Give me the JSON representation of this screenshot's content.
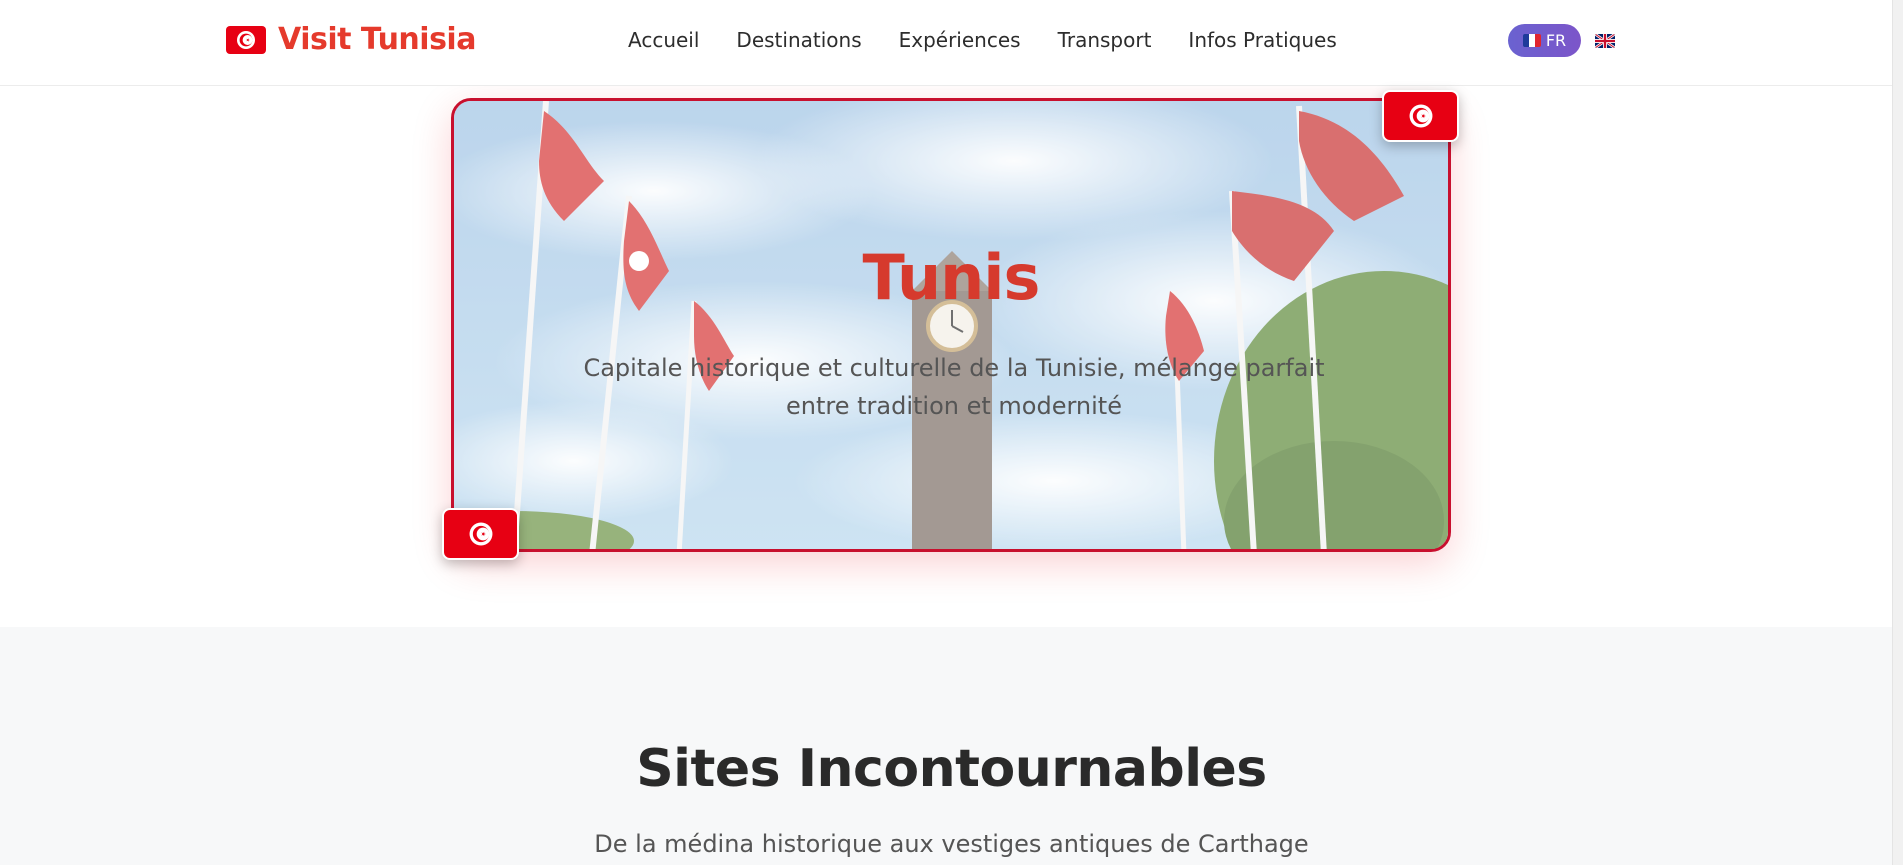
{
  "header": {
    "brand_name": "Visit Tunisia",
    "nav": [
      "Accueil",
      "Destinations",
      "Expériences",
      "Transport",
      "Infos Pratiques"
    ],
    "language": {
      "current": "FR",
      "alternate_icon": "uk-flag-icon"
    }
  },
  "hero": {
    "title": "Tunis",
    "subtitle": "Capitale historique et culturelle de la Tunisie, mélange parfait entre tradition et modernité",
    "image": "tunis-clock-tower-flags-photo"
  },
  "section": {
    "title": "Sites Incontournables",
    "subtitle": "De la médina historique aux vestiges antiques de Carthage"
  },
  "colors": {
    "tunisia_red": "#e70013",
    "brand_red": "#e53a2c",
    "hero_border": "#c8102e",
    "lang_pill": "#6a62d0",
    "section_bg": "#f7f8f9"
  },
  "icons": [
    "tunisia-flag-icon",
    "france-flag-icon",
    "uk-flag-icon"
  ]
}
